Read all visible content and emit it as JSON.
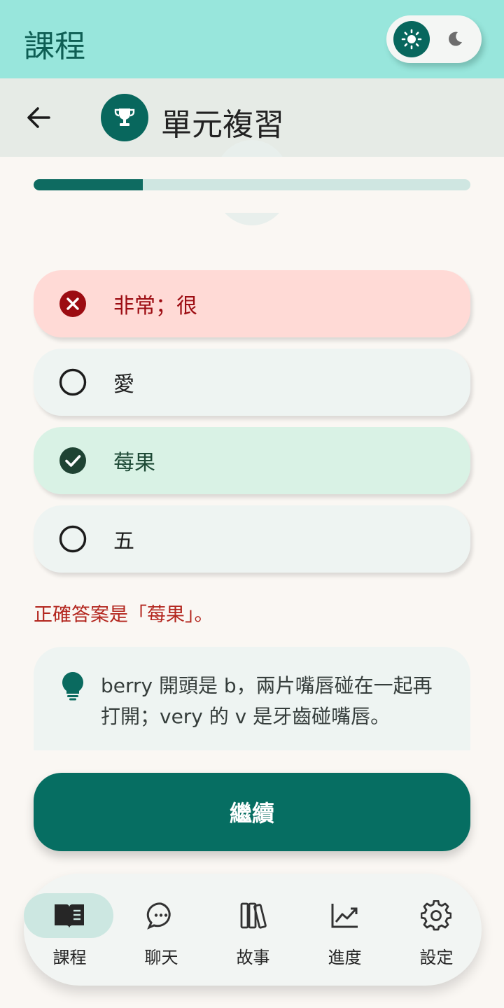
{
  "appbar": {
    "title": "課程"
  },
  "theme_toggle": {
    "light_icon": "sun-icon",
    "dark_icon": "moon-icon",
    "selected": "light"
  },
  "header": {
    "back_icon": "arrow-left-icon",
    "badge_icon": "trophy-icon",
    "title": "單元複習"
  },
  "progress": {
    "value": 0.25
  },
  "options": [
    {
      "label": "非常；很",
      "state": "wrong",
      "icon": "x-circle-icon"
    },
    {
      "label": "愛",
      "state": "neutral",
      "icon": "radio-empty-icon"
    },
    {
      "label": "莓果",
      "state": "correct",
      "icon": "check-circle-icon"
    },
    {
      "label": "五",
      "state": "neutral",
      "icon": "radio-empty-icon"
    }
  ],
  "feedback": {
    "text": "正確答案是「莓果」。"
  },
  "hint": {
    "icon": "lightbulb-icon",
    "text": "berry 開頭是 b，兩片嘴唇碰在一起再打開；very 的 v 是牙齒碰嘴唇。"
  },
  "continue_label": "繼續",
  "nav": {
    "items": [
      {
        "label": "課程",
        "icon": "book-icon",
        "active": true
      },
      {
        "label": "聊天",
        "icon": "chat-icon",
        "active": false
      },
      {
        "label": "故事",
        "icon": "books-icon",
        "active": false
      },
      {
        "label": "進度",
        "icon": "chart-icon",
        "active": false
      },
      {
        "label": "設定",
        "icon": "gear-icon",
        "active": false
      }
    ]
  },
  "colors": {
    "accent": "#066e62",
    "appbar": "#98e6dc",
    "wrong": "#9c0c12",
    "correct": "#1e4a36"
  }
}
